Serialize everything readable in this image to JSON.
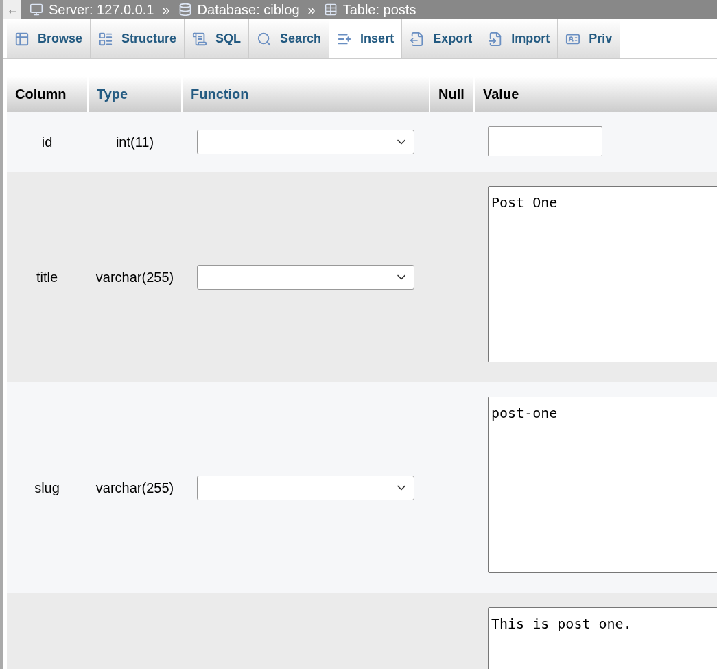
{
  "breadcrumb": {
    "back": "←",
    "items": [
      {
        "kind": "server",
        "label": "Server: 127.0.0.1"
      },
      {
        "kind": "database",
        "label": "Database: ciblog"
      },
      {
        "kind": "table",
        "label": "Table: posts"
      }
    ],
    "separator": "»"
  },
  "tabs": [
    {
      "kind": "browse",
      "label": "Browse",
      "selected": false
    },
    {
      "kind": "structure",
      "label": "Structure",
      "selected": false
    },
    {
      "kind": "sql",
      "label": "SQL",
      "selected": false
    },
    {
      "kind": "search",
      "label": "Search",
      "selected": false
    },
    {
      "kind": "insert",
      "label": "Insert",
      "selected": true
    },
    {
      "kind": "export",
      "label": "Export",
      "selected": false
    },
    {
      "kind": "import",
      "label": "Import",
      "selected": false
    },
    {
      "kind": "privileges",
      "label": "Priv",
      "selected": false
    }
  ],
  "table": {
    "columns": [
      {
        "label": "Column",
        "link": false
      },
      {
        "label": "Type",
        "link": true
      },
      {
        "label": "Function",
        "link": true
      },
      {
        "label": "Null",
        "link": false
      },
      {
        "label": "Value",
        "link": false
      }
    ],
    "rows": [
      {
        "column": "id",
        "type": "int(11)",
        "kind": "input",
        "value": ""
      },
      {
        "column": "title",
        "type": "varchar(255)",
        "kind": "textarea",
        "value": "Post One"
      },
      {
        "column": "slug",
        "type": "varchar(255)",
        "kind": "textarea",
        "value": "post-one"
      },
      {
        "kind": "textarea",
        "value": "This is post one."
      }
    ]
  }
}
